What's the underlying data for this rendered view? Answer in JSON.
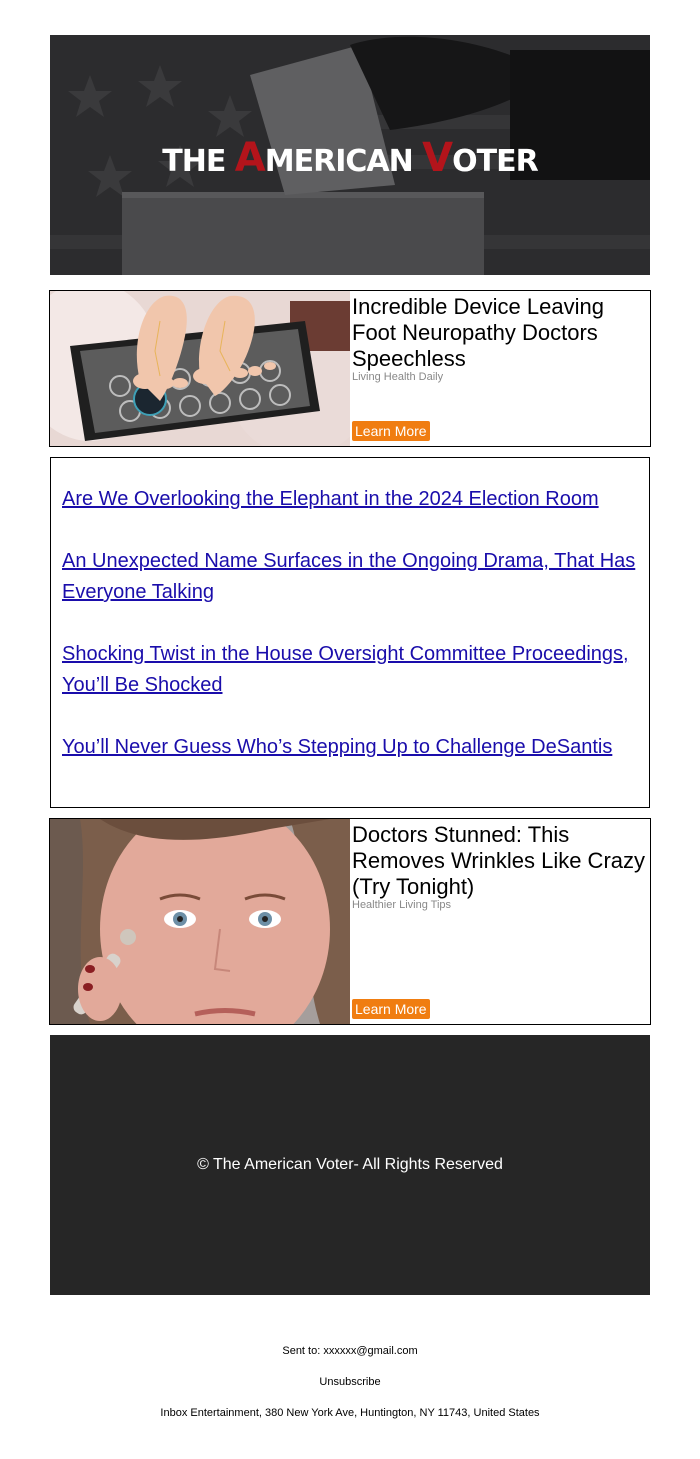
{
  "header": {
    "logo_prefix": "THE ",
    "logo_a": "A",
    "logo_merican": "MERICAN ",
    "logo_v": "V",
    "logo_oter": "OTER"
  },
  "ads": [
    {
      "title": "Incredible Device Leaving Foot Neuropathy Doctors Speechless",
      "source": "Living Health Daily",
      "button": "Learn More"
    },
    {
      "title": "Doctors Stunned: This Removes Wrinkles Like Crazy (Try Tonight)",
      "source": "Healthier Living Tips",
      "button": "Learn More"
    }
  ],
  "links": [
    "Are We Overlooking the Elephant in the 2024 Election Room",
    "An Unexpected Name Surfaces in the Ongoing Drama, That Has Everyone Talking",
    "Shocking Twist in the House Oversight Committee Proceedings, You’ll Be Shocked",
    "You’ll Never Guess Who’s Stepping Up to Challenge DeSantis"
  ],
  "footer": {
    "copyright": "© The American Voter- All Rights Reserved",
    "sent_to": "Sent to: xxxxxx@gmail.com",
    "unsubscribe": "Unsubscribe",
    "address": "Inbox Entertainment, 380 New York Ave, Huntington, NY 11743, United States"
  },
  "colors": {
    "accent_red": "#b3141b",
    "button_orange": "#f07d11",
    "link_blue": "#1a0dab",
    "footer_bg": "#262626"
  }
}
